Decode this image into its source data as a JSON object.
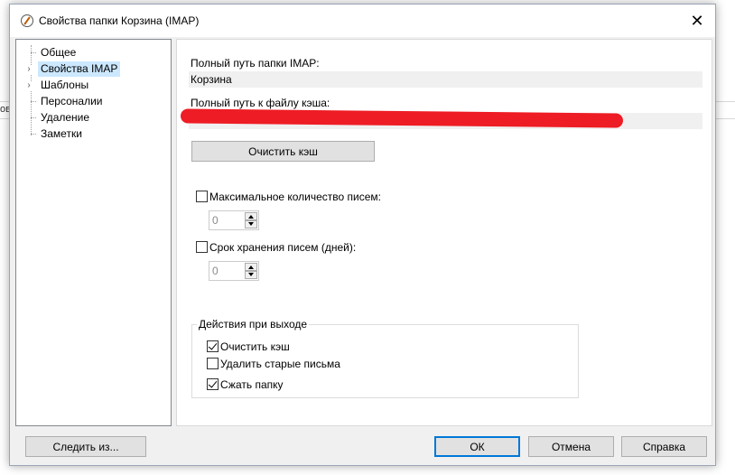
{
  "background": {
    "partial_text": "ов"
  },
  "window": {
    "title": "Свойства папки Корзина (IMAP)",
    "close_glyph": "✕"
  },
  "tree": {
    "items": [
      {
        "label": "Общее",
        "expandable": false,
        "selected": false
      },
      {
        "label": "Свойства IMAP",
        "expandable": true,
        "selected": true
      },
      {
        "label": "Шаблоны",
        "expandable": true,
        "selected": false
      },
      {
        "label": "Персоналии",
        "expandable": false,
        "selected": false
      },
      {
        "label": "Удаление",
        "expandable": false,
        "selected": false
      },
      {
        "label": "Заметки",
        "expandable": false,
        "selected": false
      }
    ],
    "expander_glyph": "›"
  },
  "panel": {
    "imap_path_label": "Полный путь папки IMAP:",
    "imap_path_value": "Корзина",
    "cache_path_label": "Полный путь к файлу кэша:",
    "cache_path_value": "",
    "clear_cache_button": "Очистить кэш",
    "max_messages": {
      "label": "Максимальное количество писем:",
      "checked": false,
      "value": "0"
    },
    "retention_days": {
      "label": "Срок хранения писем (дней):",
      "checked": false,
      "value": "0"
    },
    "on_exit_group": {
      "title": "Действия при выходе",
      "options": [
        {
          "label": "Очистить кэш",
          "checked": true
        },
        {
          "label": "Удалить старые письма",
          "checked": false
        },
        {
          "label": "Сжать папку",
          "checked": true
        }
      ]
    }
  },
  "footer": {
    "follow_button": "Следить из...",
    "ok_button": "ОК",
    "cancel_button": "Отмена",
    "help_button": "Справка"
  },
  "colors": {
    "accent": "#0078d7",
    "selection": "#cce8ff",
    "redaction": "#ee1c24"
  }
}
